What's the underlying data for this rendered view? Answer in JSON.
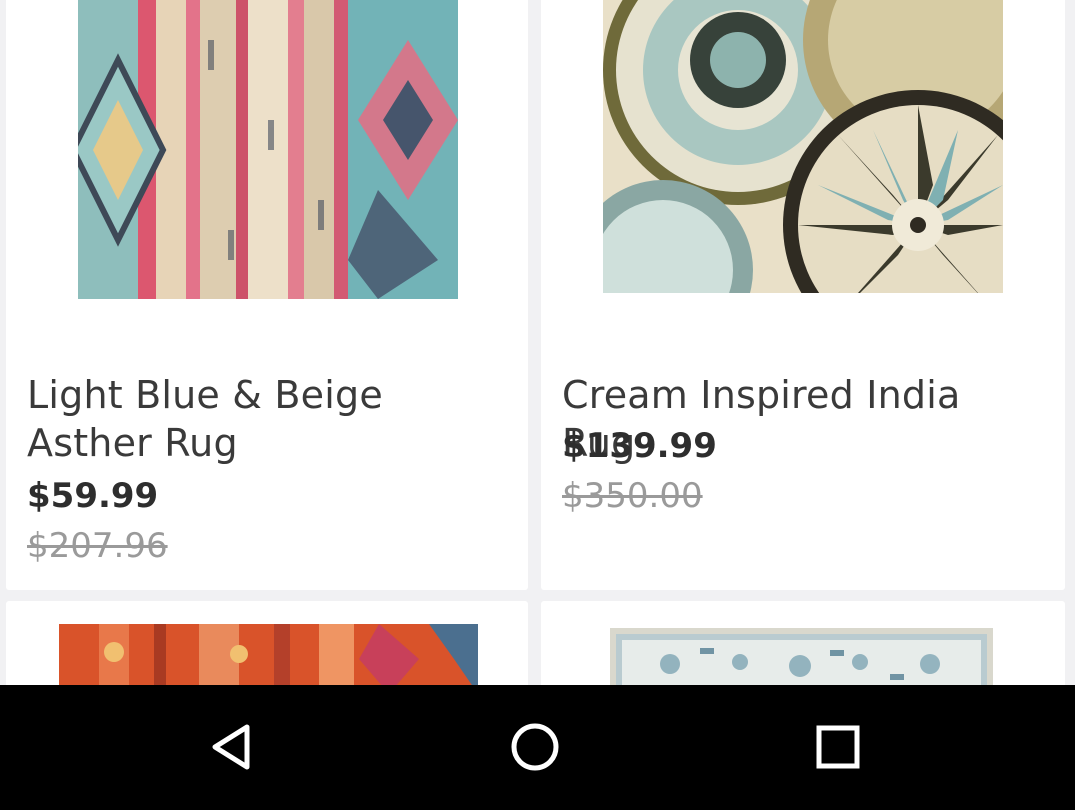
{
  "products": [
    {
      "title": "Light Blue & Beige Asther Rug",
      "price": "$59.99",
      "original_price": "$207.96",
      "image": "rug-light-blue-beige-asther"
    },
    {
      "title": "Cream Inspired India Rug",
      "price": "$139.99",
      "original_price": "$350.00",
      "image": "rug-cream-inspired-india"
    },
    {
      "image": "rug-orange-distressed"
    },
    {
      "image": "rug-blue-white-ornate"
    }
  ],
  "navbar": {
    "back_icon": "back-triangle-icon",
    "home_icon": "home-circle-icon",
    "recents_icon": "recents-square-icon"
  },
  "colors": {
    "page_background": "#f1f1f3",
    "card_background": "#ffffff",
    "title_text": "#3a3a3a",
    "price_text": "#2e2e2e",
    "original_price_text": "#9a9a9a",
    "navbar_background": "#000000",
    "navbar_icon": "#ffffff"
  }
}
